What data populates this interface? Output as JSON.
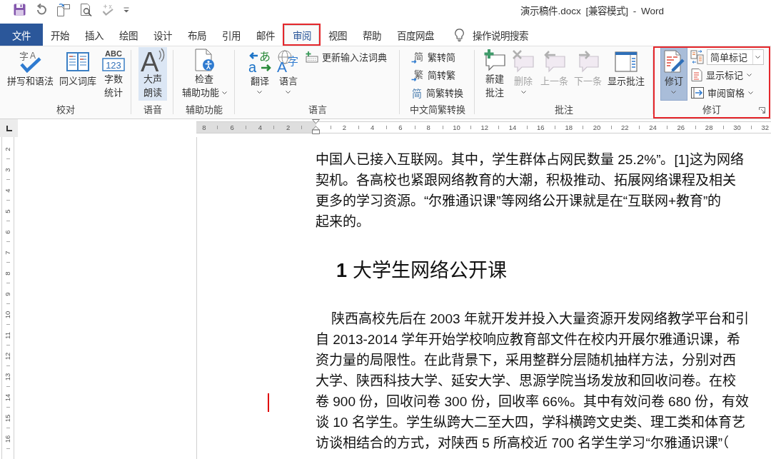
{
  "window": {
    "title": "演示稿件.docx [兼容模式] - Word"
  },
  "tabs": [
    {
      "label": "文件",
      "kind": "file",
      "selected": false,
      "highlighted": false
    },
    {
      "label": "开始",
      "kind": "tab",
      "selected": false,
      "highlighted": false
    },
    {
      "label": "插入",
      "kind": "tab",
      "selected": false,
      "highlighted": false
    },
    {
      "label": "绘图",
      "kind": "tab",
      "selected": false,
      "highlighted": false
    },
    {
      "label": "设计",
      "kind": "tab",
      "selected": false,
      "highlighted": false
    },
    {
      "label": "布局",
      "kind": "tab",
      "selected": false,
      "highlighted": false
    },
    {
      "label": "引用",
      "kind": "tab",
      "selected": false,
      "highlighted": false
    },
    {
      "label": "邮件",
      "kind": "tab",
      "selected": false,
      "highlighted": false
    },
    {
      "label": "审阅",
      "kind": "tab",
      "selected": true,
      "highlighted": true
    },
    {
      "label": "视图",
      "kind": "tab",
      "selected": false,
      "highlighted": false
    },
    {
      "label": "帮助",
      "kind": "tab",
      "selected": false,
      "highlighted": false
    },
    {
      "label": "百度网盘",
      "kind": "tab",
      "selected": false,
      "highlighted": false
    }
  ],
  "tell_me": {
    "label": "操作说明搜索"
  },
  "ribbon": {
    "groups": [
      {
        "label": "校对",
        "highlighted": false,
        "dialog_launcher": false,
        "controls": [
          {
            "kind": "large",
            "lines": [
              "拼写和语法"
            ],
            "icon_text": [
              "字",
              "A"
            ],
            "dropdown": false,
            "hovered": false,
            "pressed": false,
            "disabled": false
          },
          {
            "kind": "large",
            "lines": [
              "同义词库"
            ],
            "dropdown": false,
            "hovered": false,
            "pressed": false,
            "disabled": false
          },
          {
            "kind": "large",
            "lines": [
              "字数",
              "统计"
            ],
            "icon_text": [
              "ABC",
              "123"
            ],
            "dropdown": false,
            "hovered": false,
            "pressed": false,
            "disabled": false
          }
        ]
      },
      {
        "label": "语音",
        "highlighted": false,
        "dialog_launcher": false,
        "controls": [
          {
            "kind": "large",
            "lines": [
              "大声",
              "朗读"
            ],
            "icon_text": [
              "A"
            ],
            "dropdown": false,
            "hovered": true,
            "pressed": false,
            "disabled": false
          }
        ]
      },
      {
        "label": "辅助功能",
        "highlighted": false,
        "dialog_launcher": false,
        "controls": [
          {
            "kind": "large",
            "lines": [
              "检查",
              "辅助功能"
            ],
            "dropdown": true,
            "hovered": false,
            "pressed": false,
            "disabled": false
          }
        ]
      },
      {
        "label": "语言",
        "highlighted": false,
        "dialog_launcher": false,
        "controls": [
          {
            "kind": "large",
            "lines": [
              "翻译"
            ],
            "icon_text": [
              "a",
              "あ"
            ],
            "dropdown": true,
            "hovered": false,
            "pressed": false,
            "disabled": false
          },
          {
            "kind": "large",
            "lines": [
              "语言"
            ],
            "icon_text": [
              "A",
              "字"
            ],
            "dropdown": true,
            "hovered": false,
            "pressed": false,
            "disabled": false
          },
          {
            "kind": "small",
            "label": "更新输入法词典",
            "dropdown": false,
            "hovered": false,
            "pressed": false,
            "disabled": false
          }
        ]
      },
      {
        "label": "中文简繁转换",
        "highlighted": false,
        "dialog_launcher": false,
        "controls": [
          {
            "kind": "small",
            "label": "繁转简",
            "icon_text": [
              "简"
            ],
            "dropdown": false,
            "hovered": false,
            "pressed": false,
            "disabled": false
          },
          {
            "kind": "small",
            "label": "简转繁",
            "icon_text": [
              "繁"
            ],
            "dropdown": false,
            "hovered": false,
            "pressed": false,
            "disabled": false
          },
          {
            "kind": "small",
            "label": "简繁转换",
            "icon_text": [
              "简"
            ],
            "dropdown": false,
            "hovered": false,
            "pressed": false,
            "disabled": false
          }
        ]
      },
      {
        "label": "批注",
        "highlighted": false,
        "dialog_launcher": false,
        "controls": [
          {
            "kind": "large",
            "lines": [
              "新建",
              "批注"
            ],
            "dropdown": false,
            "hovered": false,
            "pressed": false,
            "disabled": false
          },
          {
            "kind": "large",
            "lines": [
              "删除"
            ],
            "dropdown": true,
            "hovered": false,
            "pressed": false,
            "disabled": true
          },
          {
            "kind": "large",
            "lines": [
              "上一条"
            ],
            "dropdown": false,
            "hovered": false,
            "pressed": false,
            "disabled": true
          },
          {
            "kind": "large",
            "lines": [
              "下一条"
            ],
            "dropdown": false,
            "hovered": false,
            "pressed": false,
            "disabled": true
          },
          {
            "kind": "large",
            "lines": [
              "显示批注"
            ],
            "dropdown": false,
            "hovered": false,
            "pressed": false,
            "disabled": false
          }
        ]
      },
      {
        "label": "修订",
        "highlighted": true,
        "dialog_launcher": true,
        "controls": [
          {
            "kind": "large",
            "lines": [
              "修订"
            ],
            "dropdown": true,
            "hovered": false,
            "pressed": true,
            "disabled": false
          },
          {
            "kind": "combo",
            "value": "简单标记",
            "dropdown": true,
            "hovered": false,
            "pressed": false,
            "disabled": false
          },
          {
            "kind": "small",
            "label": "显示标记",
            "dropdown": true,
            "hovered": false,
            "pressed": false,
            "disabled": false
          },
          {
            "kind": "small",
            "label": "审阅窗格",
            "dropdown": true,
            "hovered": false,
            "pressed": false,
            "disabled": false
          }
        ]
      }
    ]
  },
  "ruler": {
    "left_labels": [
      "8",
      "6",
      "4",
      "2"
    ],
    "right_labels": [
      "2",
      "4",
      "6",
      "8",
      "10",
      "12",
      "14",
      "16",
      "18",
      "20",
      "22",
      "24",
      "26",
      "28",
      "30",
      "32"
    ]
  },
  "vertical_ruler": {
    "labels": [
      "2",
      "3",
      "4",
      "5",
      "6",
      "7",
      "8",
      "9",
      "10",
      "11",
      "12",
      "13",
      "14",
      "15",
      "16"
    ]
  },
  "document": {
    "blocks": [
      {
        "kind": "paragraph",
        "continued": true,
        "lines": [
          {
            "text": "中国人已接入互联网。其中，学生群体占网民数量 25.2%”。[1]这为网络",
            "revised": false
          },
          {
            "text": "契机。各高校也紧跟网络教育的大潮，积极推动、拓展网络课程及相关",
            "revised": false
          },
          {
            "text": "更多的学习资源。“尔雅通识课”等网络公开课就是在“互联网+教育”的",
            "revised": false
          },
          {
            "text": "起来的。",
            "revised": false
          }
        ]
      },
      {
        "kind": "heading",
        "text": "**1** 大学生网络公开课"
      },
      {
        "kind": "paragraph",
        "continued": false,
        "lines": [
          {
            "text": "陕西高校先后在 2003 年就开发并投入大量资源开发网络教学平台和引",
            "revised": false
          },
          {
            "text": "自 2013-2014 学年开始学校响应教育部文件在校内开展尔雅通识课，希",
            "revised": false
          },
          {
            "text": "资力量的局限性。在此背景下，采用整群分层随机抽样方法，分别对西",
            "revised": false
          },
          {
            "text": "大学、陕西科技大学、延安大学、思源学院当场发放和回收问卷。在校",
            "revised": false
          },
          {
            "text": "卷 900 份，回收问卷 300 份，回收率 66%。其中有效问卷 680 份，有效",
            "revised": true
          },
          {
            "text": "谈 10 名学生。学生纵跨大二至大四，学科横跨文史类、理工类和体育艺",
            "revised": false
          },
          {
            "text": "访谈相结合的方式，对陕西 5 所高校近 700 名学生学习“尔雅通识课”（",
            "revised": false
          }
        ]
      }
    ]
  }
}
